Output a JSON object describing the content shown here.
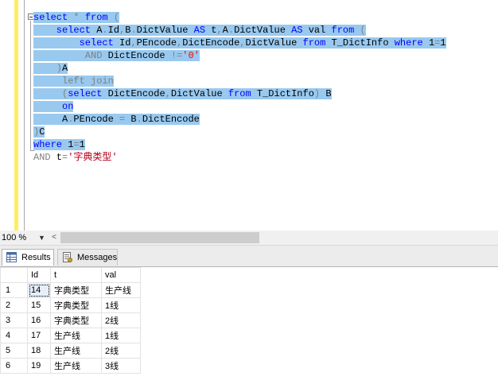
{
  "editor": {
    "lines": [
      [
        {
          "t": "select",
          "c": "kw"
        },
        {
          "t": " * ",
          "c": "gr"
        },
        {
          "t": "from",
          "c": "kw"
        },
        {
          "t": " (",
          "c": "gr"
        }
      ],
      [
        {
          "t": "    select",
          "c": "kw"
        },
        {
          "t": " A",
          "c": "bk"
        },
        {
          "t": ".",
          "c": "gr"
        },
        {
          "t": "Id",
          "c": "bk"
        },
        {
          "t": ",",
          "c": "gr"
        },
        {
          "t": "B",
          "c": "bk"
        },
        {
          "t": ".",
          "c": "gr"
        },
        {
          "t": "DictValue ",
          "c": "bk"
        },
        {
          "t": "AS",
          "c": "kw"
        },
        {
          "t": " t",
          "c": "bk"
        },
        {
          "t": ",",
          "c": "gr"
        },
        {
          "t": "A",
          "c": "bk"
        },
        {
          "t": ".",
          "c": "gr"
        },
        {
          "t": "DictValue ",
          "c": "bk"
        },
        {
          "t": "AS",
          "c": "kw"
        },
        {
          "t": " val ",
          "c": "bk"
        },
        {
          "t": "from",
          "c": "kw"
        },
        {
          "t": " (",
          "c": "gr"
        }
      ],
      [
        {
          "t": "        select",
          "c": "kw"
        },
        {
          "t": " Id",
          "c": "bk"
        },
        {
          "t": ",",
          "c": "gr"
        },
        {
          "t": "PEncode",
          "c": "bk"
        },
        {
          "t": ",",
          "c": "gr"
        },
        {
          "t": "DictEncode",
          "c": "bk"
        },
        {
          "t": ",",
          "c": "gr"
        },
        {
          "t": "DictValue ",
          "c": "bk"
        },
        {
          "t": "from",
          "c": "kw"
        },
        {
          "t": " T_DictInfo ",
          "c": "bk"
        },
        {
          "t": "where",
          "c": "kw"
        },
        {
          "t": " 1",
          "c": "bk"
        },
        {
          "t": "=",
          "c": "gr"
        },
        {
          "t": "1",
          "c": "bk"
        }
      ],
      [
        {
          "t": "         AND",
          "c": "gr"
        },
        {
          "t": " DictEncode ",
          "c": "bk"
        },
        {
          "t": "!=",
          "c": "gr"
        },
        {
          "t": "'0'",
          "c": "str"
        }
      ],
      [
        {
          "t": "    )",
          "c": "gr"
        },
        {
          "t": "A",
          "c": "bk"
        }
      ],
      [
        {
          "t": "     left join",
          "c": "gr"
        }
      ],
      [
        {
          "t": "     (",
          "c": "gr"
        },
        {
          "t": "select",
          "c": "kw"
        },
        {
          "t": " DictEncode",
          "c": "bk"
        },
        {
          "t": ",",
          "c": "gr"
        },
        {
          "t": "DictValue ",
          "c": "bk"
        },
        {
          "t": "from",
          "c": "kw"
        },
        {
          "t": " T_DictInfo",
          "c": "bk"
        },
        {
          "t": ") ",
          "c": "gr"
        },
        {
          "t": "B",
          "c": "bk"
        }
      ],
      [
        {
          "t": "     on",
          "c": "kw"
        }
      ],
      [
        {
          "t": "     A",
          "c": "bk"
        },
        {
          "t": ".",
          "c": "gr"
        },
        {
          "t": "PEncode ",
          "c": "bk"
        },
        {
          "t": "=",
          "c": "gr"
        },
        {
          "t": " B",
          "c": "bk"
        },
        {
          "t": ".",
          "c": "gr"
        },
        {
          "t": "DictEncode",
          "c": "bk"
        }
      ],
      [
        {
          "t": ")",
          "c": "gr"
        },
        {
          "t": "C",
          "c": "bk"
        }
      ],
      [
        {
          "t": "where",
          "c": "kw"
        },
        {
          "t": " 1",
          "c": "bk"
        },
        {
          "t": "=",
          "c": "gr"
        },
        {
          "t": "1",
          "c": "bk"
        }
      ],
      [
        {
          "t": "AND",
          "c": "gr"
        },
        {
          "t": " t",
          "c": "bk"
        },
        {
          "t": "=",
          "c": "gr"
        },
        {
          "t": "'字典类型'",
          "c": "str2"
        }
      ]
    ],
    "selected_lines": 11
  },
  "zoom": {
    "value": "100 %"
  },
  "tabs": [
    {
      "label": "Results",
      "icon": "results-grid-icon",
      "active": true
    },
    {
      "label": "Messages",
      "icon": "messages-icon",
      "active": false
    }
  ],
  "grid": {
    "columns": [
      "Id",
      "t",
      "val"
    ],
    "rows": [
      {
        "num": "1",
        "cells": [
          "14",
          "字典类型",
          "生产线"
        ]
      },
      {
        "num": "2",
        "cells": [
          "15",
          "字典类型",
          "1线"
        ]
      },
      {
        "num": "3",
        "cells": [
          "16",
          "字典类型",
          "2线"
        ]
      },
      {
        "num": "4",
        "cells": [
          "17",
          "生产线",
          "1线"
        ]
      },
      {
        "num": "5",
        "cells": [
          "18",
          "生产线",
          "2线"
        ]
      },
      {
        "num": "6",
        "cells": [
          "19",
          "生产线",
          "3线"
        ]
      }
    ]
  },
  "colors": {
    "selection": "#99c9ef",
    "keyword": "#0000ff",
    "operator": "#808080",
    "string": "#ff0000",
    "margin": "#ffee62"
  }
}
